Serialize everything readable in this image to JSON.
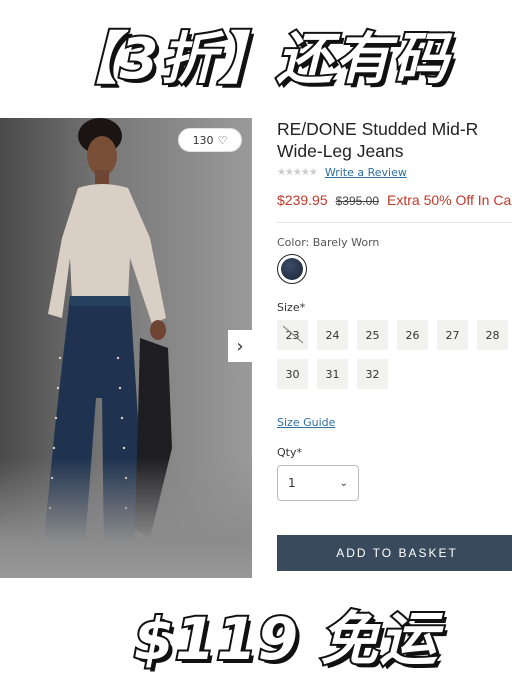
{
  "banner": {
    "top_text": "【3折】还有码",
    "bottom_text": "$119 免运"
  },
  "gallery": {
    "favorites_count": "130",
    "heart_icon": "heart-icon",
    "next_icon": "chevron-right-icon"
  },
  "product": {
    "title_line1": "RE/DONE Studded Mid-R",
    "title_line2": "Wide-Leg Jeans",
    "rating_stars": "★★★★★",
    "write_review": "Write a Review",
    "price_now": "$239.95",
    "price_was": "$395.00",
    "price_extra": "Extra 50% Off In Ca",
    "color_label": "Color: Barely Worn",
    "size_label": "Size*",
    "sizes": [
      {
        "label": "23",
        "available": false
      },
      {
        "label": "24",
        "available": true
      },
      {
        "label": "25",
        "available": true
      },
      {
        "label": "26",
        "available": true
      },
      {
        "label": "27",
        "available": true
      },
      {
        "label": "28",
        "available": true
      },
      {
        "label": "30",
        "available": true
      },
      {
        "label": "31",
        "available": true
      },
      {
        "label": "32",
        "available": true
      }
    ],
    "size_guide": "Size Guide",
    "qty_label": "Qty*",
    "qty_value": "1",
    "add_to_basket": "ADD TO BASKET"
  },
  "colors": {
    "price_red": "#c0392b",
    "link_blue": "#2e6f9e",
    "basket_bg": "#394a5c"
  }
}
